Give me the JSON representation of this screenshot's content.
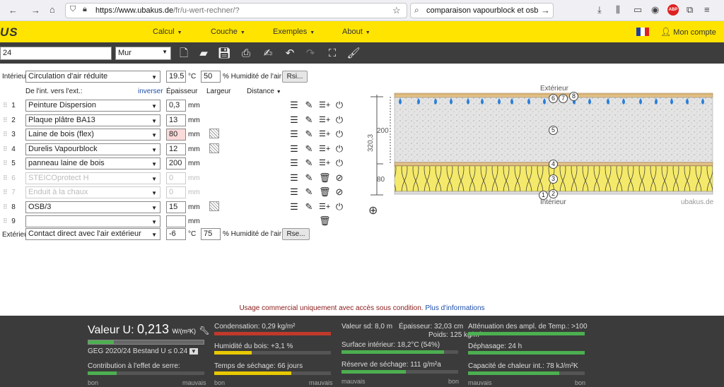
{
  "browser": {
    "url_host": "https://www.ubakus.de",
    "url_path": "/fr/u-wert-rechner/?",
    "search": "comparaison vapourblock et osb",
    "abp_label": "ABP"
  },
  "nav": {
    "logo": "US",
    "items": [
      "Calcul",
      "Couche",
      "Exemples",
      "About"
    ],
    "account": "Mon compte"
  },
  "toolbar": {
    "name_value": "24",
    "type_value": "Mur"
  },
  "interior": {
    "label": "Intérieur",
    "condition": "Circulation d'air réduite",
    "temp": "19.5",
    "temp_unit": "°C",
    "humidity": "50",
    "humidity_label": "% Humidité de l'air",
    "button": "Rsi..."
  },
  "headers": {
    "direction": "De l'int. vers l'ext.:",
    "invert": "inverser",
    "thickness": "Épaisseur",
    "width": "Largeur",
    "distance": "Distance"
  },
  "layers": [
    {
      "num": "1",
      "name": "Peinture Dispersion",
      "thickness": "0,3",
      "unit": "mm",
      "disabled": false
    },
    {
      "num": "2",
      "name": "Plaque plâtre BA13",
      "thickness": "13",
      "unit": "mm",
      "disabled": false
    },
    {
      "num": "3",
      "name": "Laine de bois (flex)",
      "thickness": "80",
      "unit": "mm",
      "disabled": false
    },
    {
      "num": "4",
      "name": "Durelis Vapourblock",
      "thickness": "12",
      "unit": "mm",
      "disabled": false
    },
    {
      "num": "5",
      "name": "panneau laine de bois",
      "thickness": "200",
      "unit": "mm",
      "disabled": false
    },
    {
      "num": "6",
      "name": "STEICOprotect H",
      "thickness": "0",
      "unit": "mm",
      "disabled": true
    },
    {
      "num": "7",
      "name": "Enduit à la chaux",
      "thickness": "0",
      "unit": "mm",
      "disabled": true
    },
    {
      "num": "8",
      "name": "OSB/3",
      "thickness": "15",
      "unit": "mm",
      "disabled": false
    },
    {
      "num": "9",
      "name": "",
      "thickness": "",
      "unit": "mm",
      "disabled": false
    }
  ],
  "exterior": {
    "label": "Extérieur",
    "condition": "Contact direct avec l'air extérieur",
    "temp": "-6",
    "temp_unit": "°C",
    "humidity": "75",
    "humidity_label": "% Humidité de l'air",
    "button": "Rse..."
  },
  "diagram": {
    "top_label": "Extérieur",
    "bottom_label": "Intérieur",
    "watermark": "ubakus.de",
    "total": "320,3",
    "dim_200": "200",
    "dim_80": "80",
    "numbers": [
      "1",
      "2",
      "3",
      "4",
      "5",
      "6",
      "7",
      "8"
    ]
  },
  "notice": {
    "text": "Usage commercial uniquement avec accès sous condition.",
    "link": "Plus d'informations"
  },
  "results": {
    "u_label": "Valeur U:",
    "u_value": "0,213",
    "u_unit": "W/(m²K)",
    "geg": "GEG 2020/24 Bestand U ≤ 0.24",
    "greenhouse": "Contribution à l'effet de serre:",
    "condensation": "Condensation: 0,29 kg/m²",
    "wood_humidity": "Humidité du bois: +3,1 %",
    "drying_time": "Temps de séchage: 66 jours",
    "sd_value": "Valeur sd: 8,0 m",
    "thickness": "Épaisseur: 32,03 cm",
    "weight": "Poids: 125 kg/m²",
    "surface": "Surface intérieur: 18,2°C (54%)",
    "drying_reserve": "Réserve de séchage: 111 g/m²a",
    "attenuation": "Atténuation des ampl. de Temp.: >100",
    "phase": "Déphasage: 24 h",
    "heat_capacity": "Capacité de chaleur int.: 78 kJ/m²K",
    "good": "bon",
    "bad": "mauvais"
  },
  "colors": {
    "yellow": "#ffe400",
    "dark": "#3b3b3b",
    "green": "#4caf50",
    "yellow_bar": "#e8c800",
    "red_bar": "#c0392b"
  }
}
